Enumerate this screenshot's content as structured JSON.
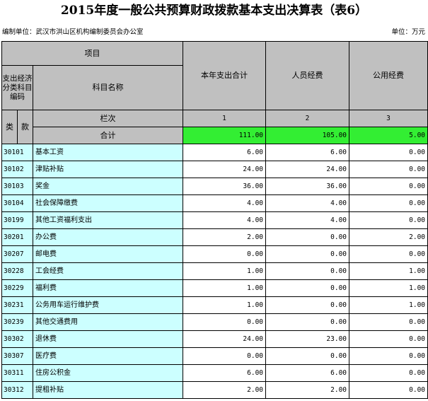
{
  "title": "2015年度一般公共预算财政拨款基本支出决算表（表6）",
  "org_label": "编制单位：武汉市洪山区机构编制委员会办公室",
  "unit_label": "单位：万元",
  "header": {
    "item": "项目",
    "econ_code": "支出经济分类科目编码",
    "subject_name": "科目名称",
    "col_total": "本年支出合计",
    "col_personnel": "人员经费",
    "col_public": "公用经费",
    "lei": "类",
    "kuan": "款",
    "lanci": "栏次",
    "num1": "1",
    "num2": "2",
    "num3": "3",
    "sum_label": "合计",
    "sum_total": "111.00",
    "sum_personnel": "105.00",
    "sum_public": "5.00"
  },
  "rows": [
    {
      "code": "30101",
      "name": "基本工资",
      "total": "6.00",
      "personnel": "6.00",
      "public": "0.00"
    },
    {
      "code": "30102",
      "name": "津贴补贴",
      "total": "24.00",
      "personnel": "24.00",
      "public": "0.00"
    },
    {
      "code": "30103",
      "name": "奖金",
      "total": "36.00",
      "personnel": "36.00",
      "public": "0.00"
    },
    {
      "code": "30104",
      "name": "社会保障缴费",
      "total": "4.00",
      "personnel": "4.00",
      "public": "0.00"
    },
    {
      "code": "30199",
      "name": "其他工资福利支出",
      "total": "4.00",
      "personnel": "4.00",
      "public": "0.00"
    },
    {
      "code": "30201",
      "name": "办公费",
      "total": "2.00",
      "personnel": "0.00",
      "public": "2.00"
    },
    {
      "code": "30207",
      "name": "邮电费",
      "total": "0.00",
      "personnel": "0.00",
      "public": "0.00"
    },
    {
      "code": "30228",
      "name": "工会经费",
      "total": "1.00",
      "personnel": "0.00",
      "public": "1.00"
    },
    {
      "code": "30229",
      "name": "福利费",
      "total": "1.00",
      "personnel": "0.00",
      "public": "1.00"
    },
    {
      "code": "30231",
      "name": "公务用车运行维护费",
      "total": "1.00",
      "personnel": "0.00",
      "public": "1.00"
    },
    {
      "code": "30239",
      "name": "其他交通费用",
      "total": "0.00",
      "personnel": "0.00",
      "public": "0.00"
    },
    {
      "code": "30302",
      "name": "退休费",
      "total": "24.00",
      "personnel": "23.00",
      "public": "0.00"
    },
    {
      "code": "30307",
      "name": "医疗费",
      "total": "0.00",
      "personnel": "0.00",
      "public": "0.00"
    },
    {
      "code": "30311",
      "name": "住房公积金",
      "total": "6.00",
      "personnel": "6.00",
      "public": "0.00"
    },
    {
      "code": "30312",
      "name": "提租补贴",
      "total": "2.00",
      "personnel": "2.00",
      "public": "0.00"
    }
  ]
}
